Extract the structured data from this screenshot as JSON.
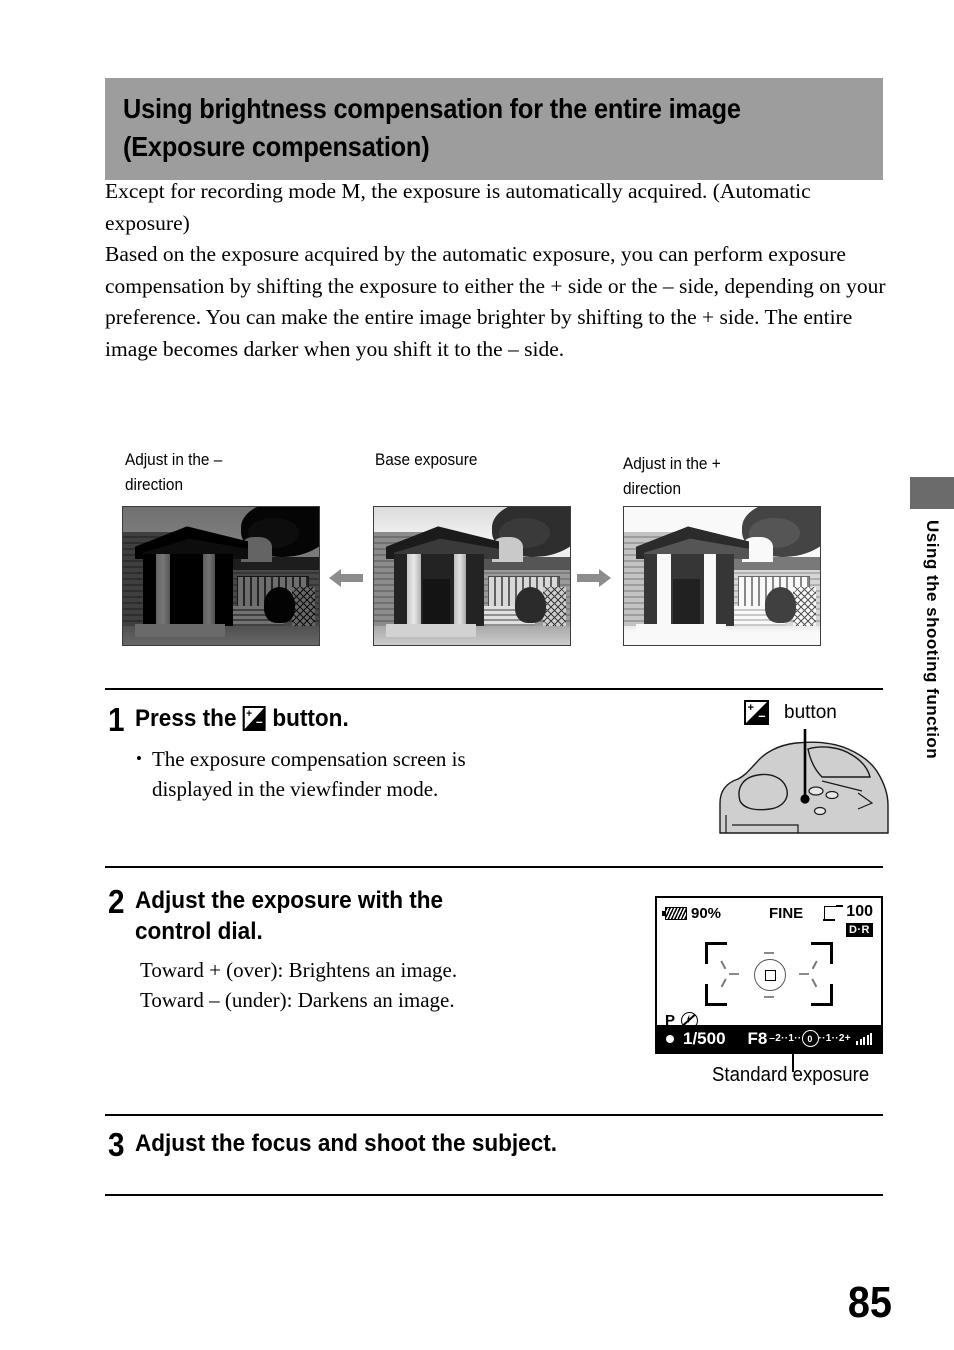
{
  "header": {
    "line1": "Using brightness compensation for the entire image",
    "line2": "(Exposure compensation)",
    "background": "#9d9d9d"
  },
  "intro": {
    "paragraph1": "Except for recording mode M, the exposure is automatically acquired. (Automatic exposure)",
    "paragraph2": "Based on the exposure acquired by the automatic exposure, you can perform exposure compensation by shifting the exposure to either the + side or the – side, depending on your preference. You can make the entire image brighter by shifting to the + side. The entire image becomes darker when you shift it to the – side."
  },
  "figure": {
    "caption_left": "Adjust in the –\ndirection",
    "caption_center": "Base exposure",
    "caption_right": "Adjust in the +\ndirection",
    "arrow_left": "arrow-left-icon",
    "arrow_right": "arrow-right-icon",
    "photo_alt_left": "under-exposed photo of house porch",
    "photo_alt_center": "base exposure photo of house porch",
    "photo_alt_right": "over-exposed photo of house porch"
  },
  "steps": [
    {
      "number": "1",
      "title_before_icon": "Press the",
      "icon": "exposure-compensation-icon",
      "title_after_icon": "button.",
      "bullet": "•",
      "bullet_text": "The exposure compensation screen is displayed in the viewfinder mode."
    },
    {
      "number": "2",
      "title": "Adjust the exposure with the\ncontrol dial.",
      "line1": "Toward + (over): Brightens an image.",
      "line2": "Toward – (under): Darkens an image."
    },
    {
      "number": "3",
      "title": "Adjust the focus and shoot the subject."
    }
  ],
  "camera_callout": {
    "icon": "exposure-compensation-icon",
    "label": "button",
    "illustration": "camera-top-view"
  },
  "lcd": {
    "battery_icon": "battery-icon",
    "battery_level": "90%",
    "quality": "FINE",
    "card_icon": "memory-card-icon",
    "shots_remaining": "100",
    "dro_badge": "D·R",
    "mode": "P",
    "flash_icon": "flash-off-icon",
    "focus_indicator": "●",
    "shutter_speed": "1/500",
    "aperture": "F8",
    "ev_scale_left": "–2",
    "ev_dots_left": "··1··",
    "ev_marker": "0",
    "ev_dots_right": "··1··",
    "ev_scale_right": "2+",
    "signal_icon": "signal-bars-icon",
    "af_area": "af-area-brackets"
  },
  "standard_exposure_label": "Standard exposure",
  "side_tab": {
    "text": "Using the shooting function",
    "tab_color": "#6b6b6b"
  },
  "page_number": "85"
}
